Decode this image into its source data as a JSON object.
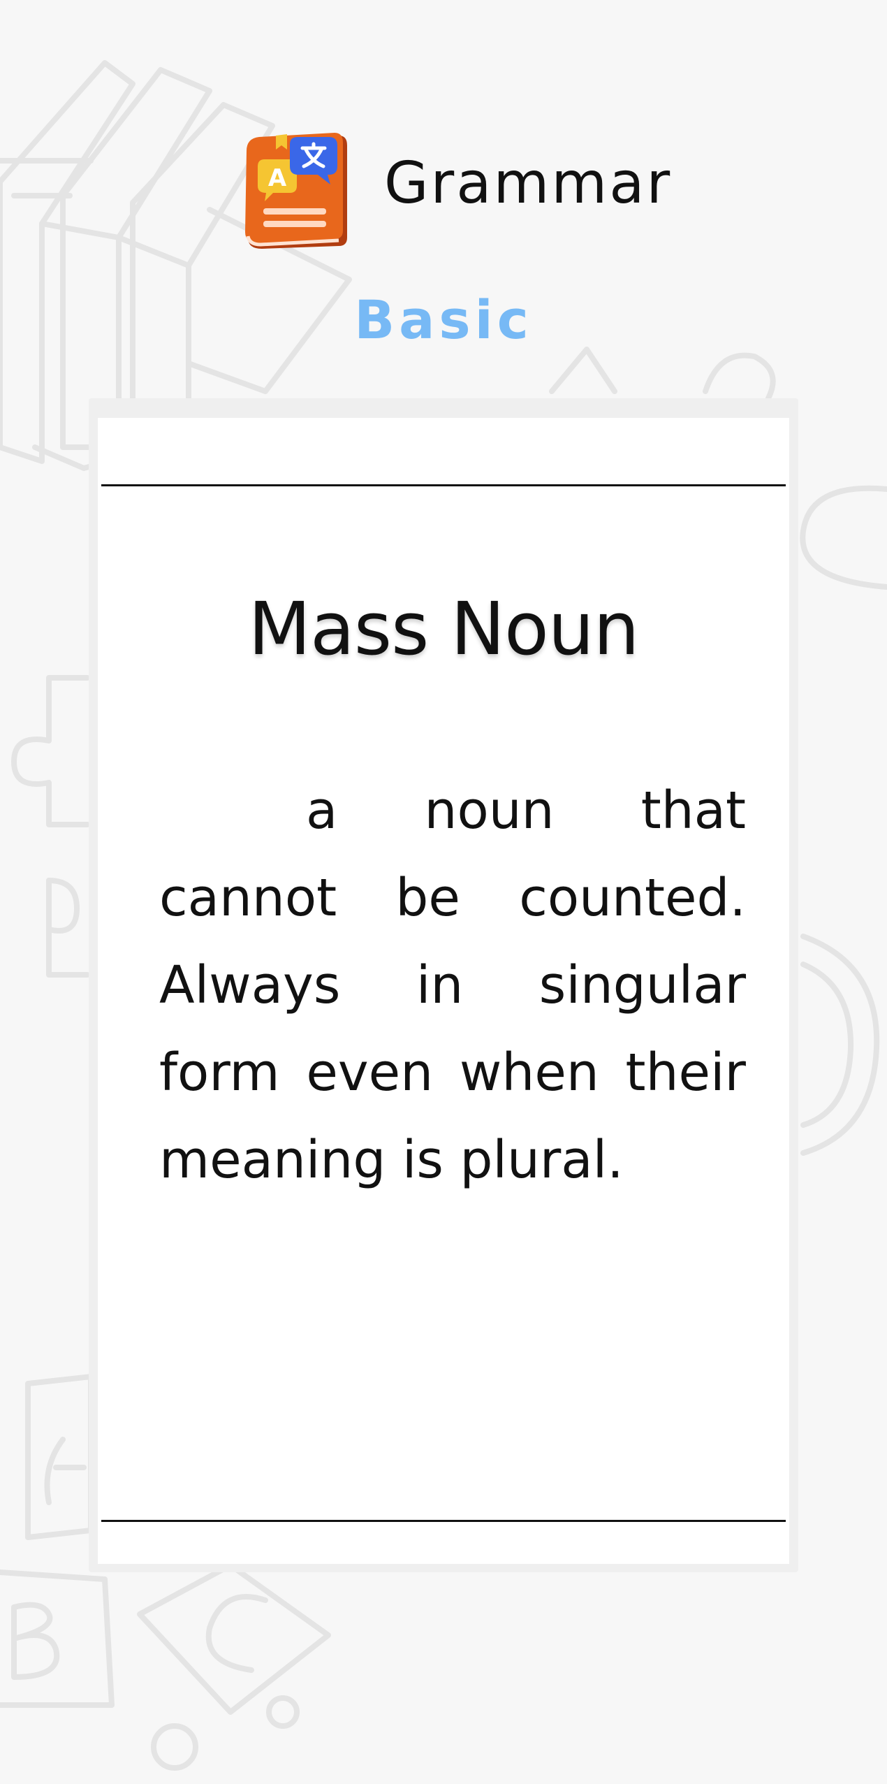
{
  "header": {
    "app_title": "Grammar",
    "level": "Basic"
  },
  "card": {
    "title": "Mass Noun",
    "definition": "a noun that cannot be counted. Always in singular form even when their meaning is plural."
  },
  "colors": {
    "background": "#f7f7f7",
    "level_text": "#77b9f5",
    "card_background": "#ffffff",
    "card_frame": "#efefef",
    "icon_book": "#e8671c",
    "icon_bubble_blue": "#3a67e8",
    "icon_bubble_yellow": "#f5c532"
  },
  "icons": {
    "app_icon": "grammar-book-translate-icon"
  }
}
